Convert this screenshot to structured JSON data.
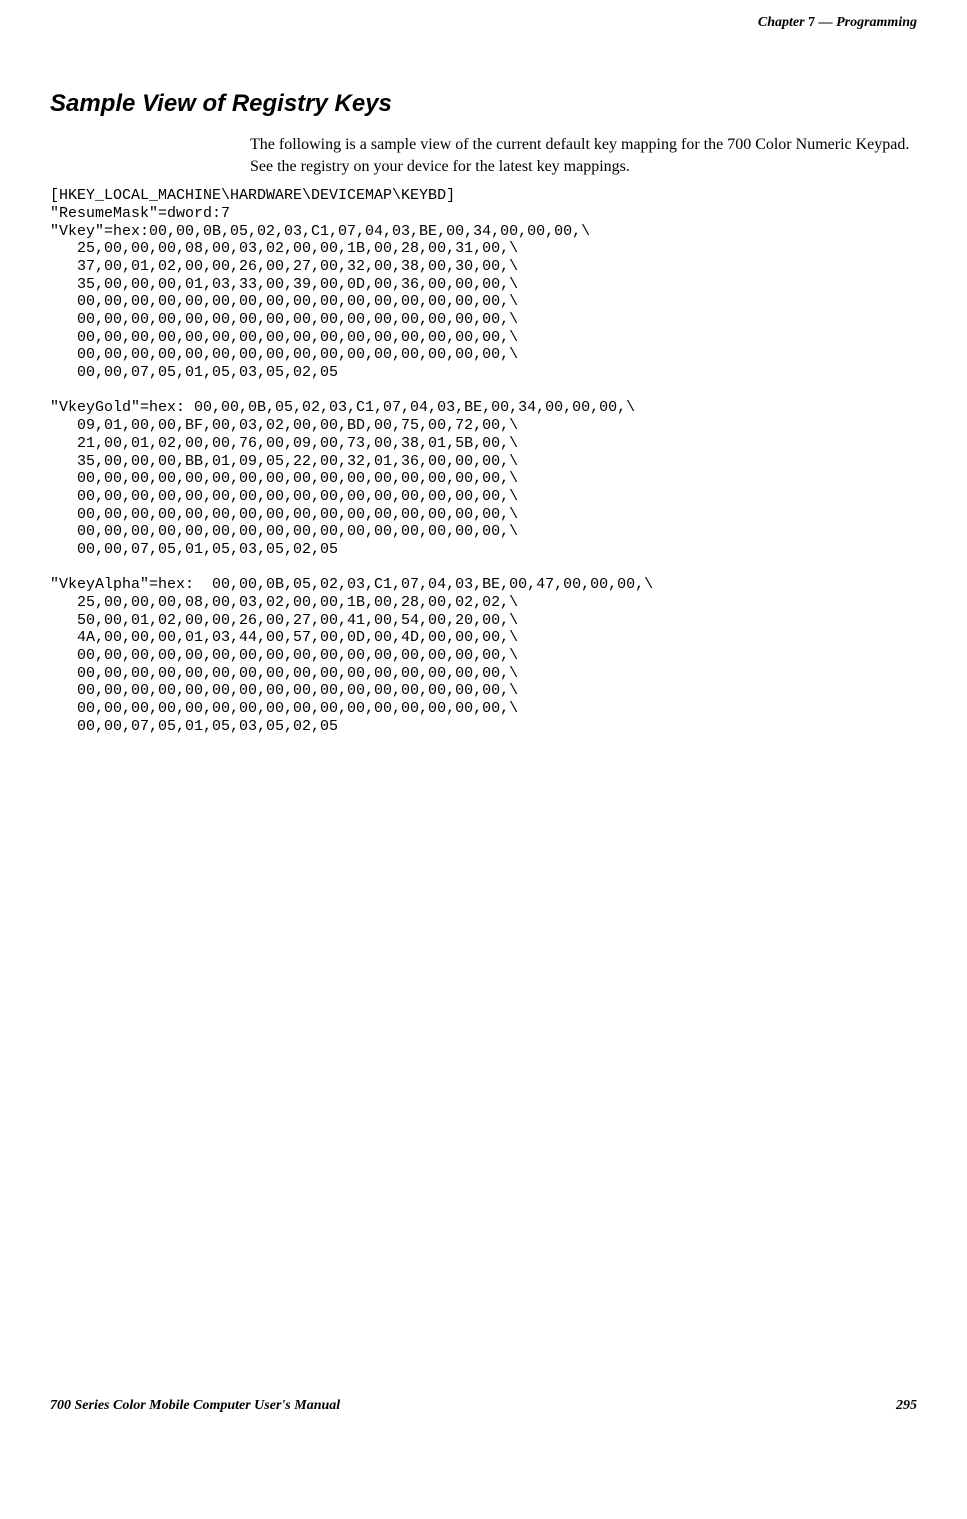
{
  "header": {
    "chapter_label": "Chapter",
    "chapter_number": "7",
    "dash": "—",
    "chapter_title": "Programming"
  },
  "heading": "Sample View of Registry Keys",
  "intro": "The following is a sample view of the current default key mapping for the 700 Color Numeric Keypad. See the registry on your device for the latest key mappings.",
  "code": "[HKEY_LOCAL_MACHINE\\HARDWARE\\DEVICEMAP\\KEYBD]\n\"ResumeMask\"=dword:7\n\"Vkey\"=hex:00,00,0B,05,02,03,C1,07,04,03,BE,00,34,00,00,00,\\\n   25,00,00,00,08,00,03,02,00,00,1B,00,28,00,31,00,\\\n   37,00,01,02,00,00,26,00,27,00,32,00,38,00,30,00,\\\n   35,00,00,00,01,03,33,00,39,00,0D,00,36,00,00,00,\\\n   00,00,00,00,00,00,00,00,00,00,00,00,00,00,00,00,\\\n   00,00,00,00,00,00,00,00,00,00,00,00,00,00,00,00,\\\n   00,00,00,00,00,00,00,00,00,00,00,00,00,00,00,00,\\\n   00,00,00,00,00,00,00,00,00,00,00,00,00,00,00,00,\\\n   00,00,07,05,01,05,03,05,02,05\n\n\"VkeyGold\"=hex: 00,00,0B,05,02,03,C1,07,04,03,BE,00,34,00,00,00,\\\n   09,01,00,00,BF,00,03,02,00,00,BD,00,75,00,72,00,\\\n   21,00,01,02,00,00,76,00,09,00,73,00,38,01,5B,00,\\\n   35,00,00,00,BB,01,09,05,22,00,32,01,36,00,00,00,\\\n   00,00,00,00,00,00,00,00,00,00,00,00,00,00,00,00,\\\n   00,00,00,00,00,00,00,00,00,00,00,00,00,00,00,00,\\\n   00,00,00,00,00,00,00,00,00,00,00,00,00,00,00,00,\\\n   00,00,00,00,00,00,00,00,00,00,00,00,00,00,00,00,\\\n   00,00,07,05,01,05,03,05,02,05\n\n\"VkeyAlpha\"=hex:  00,00,0B,05,02,03,C1,07,04,03,BE,00,47,00,00,00,\\\n   25,00,00,00,08,00,03,02,00,00,1B,00,28,00,02,02,\\\n   50,00,01,02,00,00,26,00,27,00,41,00,54,00,20,00,\\\n   4A,00,00,00,01,03,44,00,57,00,0D,00,4D,00,00,00,\\\n   00,00,00,00,00,00,00,00,00,00,00,00,00,00,00,00,\\\n   00,00,00,00,00,00,00,00,00,00,00,00,00,00,00,00,\\\n   00,00,00,00,00,00,00,00,00,00,00,00,00,00,00,00,\\\n   00,00,00,00,00,00,00,00,00,00,00,00,00,00,00,00,\\\n   00,00,07,05,01,05,03,05,02,05",
  "footer": {
    "manual_title": "700 Series Color Mobile Computer User's Manual",
    "page_number": "295"
  }
}
